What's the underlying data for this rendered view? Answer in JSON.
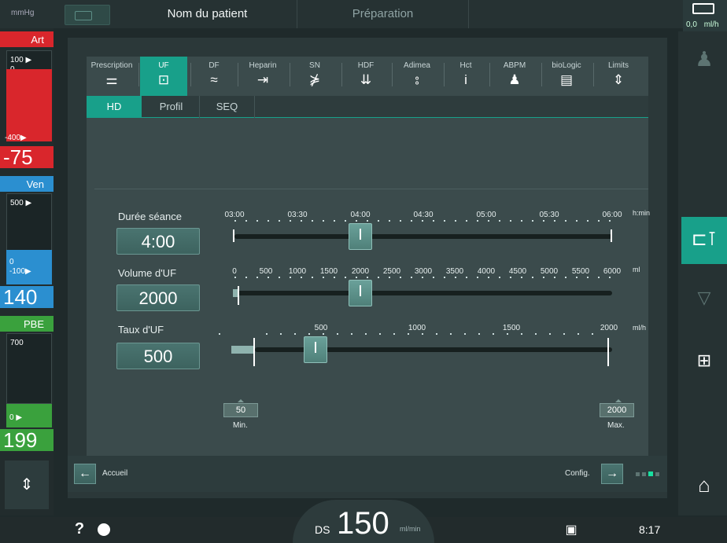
{
  "topbar": {
    "unit": "mmHg",
    "patient": "Nom du patient",
    "phase": "Préparation",
    "rate_value": "0,0",
    "rate_unit": "ml/h"
  },
  "pressures": {
    "art": {
      "title": "Art",
      "top_label": "100 ▶",
      "zero": "0",
      "bottom_label": "-400▶",
      "value": "-75"
    },
    "ven": {
      "title": "Ven",
      "top_label": "500 ▶",
      "zero": "0",
      "bottom_label": "-100▶",
      "value": "140"
    },
    "pbe": {
      "title": "PBE",
      "top_label": "700",
      "zero": "0 ▶",
      "value": "199"
    }
  },
  "tabs": [
    {
      "label": "Prescription",
      "icon": "sliders-icon",
      "glyph": "⚌"
    },
    {
      "label": "UF",
      "icon": "uf-filter-icon",
      "glyph": "⊡"
    },
    {
      "label": "DF",
      "icon": "wave-icon",
      "glyph": "≈"
    },
    {
      "label": "Heparin",
      "icon": "syringe-icon",
      "glyph": "⇥"
    },
    {
      "label": "SN",
      "icon": "single-needle-icon",
      "glyph": "⋡"
    },
    {
      "label": "HDF",
      "icon": "hdf-icon",
      "glyph": "⇊"
    },
    {
      "label": "Adimea",
      "icon": "signal-icon",
      "glyph": "⦂"
    },
    {
      "label": "Hct",
      "icon": "hct-icon",
      "glyph": "i"
    },
    {
      "label": "ABPM",
      "icon": "patient-icon",
      "glyph": "♟"
    },
    {
      "label": "bioLogic",
      "icon": "biologic-icon",
      "glyph": "▤"
    },
    {
      "label": "Limits",
      "icon": "limits-icon",
      "glyph": "⇕"
    }
  ],
  "subtabs": [
    "HD",
    "Profil",
    "SEQ"
  ],
  "duration": {
    "label": "Durée séance",
    "value": "4:00",
    "ticks": [
      "03:00",
      "03:30",
      "04:00",
      "04:30",
      "05:00",
      "05:30",
      "06:00"
    ],
    "unit": "h:min",
    "min": 3,
    "max": 6,
    "current": 4
  },
  "uf_volume": {
    "label": "Volume d'UF",
    "value": "2000",
    "ticks": [
      "0",
      "500",
      "1000",
      "1500",
      "2000",
      "2500",
      "3000",
      "3500",
      "4000",
      "4500",
      "5000",
      "5500",
      "6000"
    ],
    "unit": "ml",
    "min": 0,
    "max": 6000,
    "current": 2000
  },
  "uf_rate": {
    "label": "Taux d'UF",
    "value": "500",
    "ticks": [
      "500",
      "1000",
      "1500",
      "2000"
    ],
    "unit": "ml/h",
    "min_value": "50",
    "min_label": "Min.",
    "max_value": "2000",
    "max_label": "Max."
  },
  "nav": {
    "back_label": "Accueil",
    "config_label": "Config."
  },
  "status": {
    "help": "?",
    "ds_label": "DS",
    "ds_value": "150",
    "ds_unit": "ml/min",
    "time": "8:17"
  },
  "colors": {
    "accent": "#18a08a",
    "art": "#d9262c",
    "ven": "#2b8fd0",
    "pbe": "#3aa13d"
  }
}
